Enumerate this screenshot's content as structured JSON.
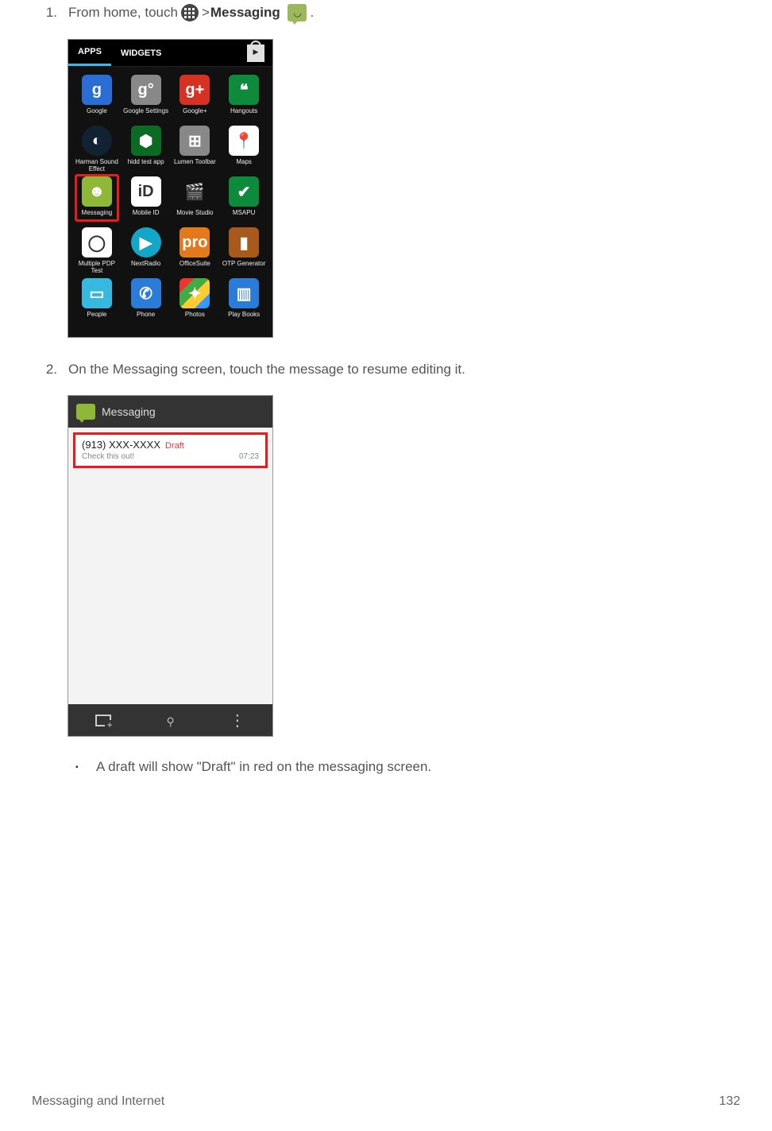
{
  "steps": {
    "one": {
      "num": "1.",
      "text_a": "From home, touch ",
      "text_b": " > ",
      "text_c": "Messaging",
      "text_d": "."
    },
    "two": {
      "num": "2.",
      "text": "On the Messaging screen, touch the message to resume editing it."
    }
  },
  "drawer": {
    "tab_apps": "APPS",
    "tab_widgets": "WIDGETS",
    "apps": [
      {
        "label": "Google",
        "glyph": "g",
        "cls": "bg-blue"
      },
      {
        "label": "Google Settings",
        "glyph": "g°",
        "cls": "bg-gray"
      },
      {
        "label": "Google+",
        "glyph": "g+",
        "cls": "bg-red"
      },
      {
        "label": "Hangouts",
        "glyph": "❝",
        "cls": "bg-green"
      },
      {
        "label": "Harman Sound Effect",
        "glyph": "◐",
        "cls": "bg-dteal"
      },
      {
        "label": "hidd test app",
        "glyph": "⬢",
        "cls": "bg-dgreen"
      },
      {
        "label": "Lumen Toolbar",
        "glyph": "⊞",
        "cls": "bg-gray"
      },
      {
        "label": "Maps",
        "glyph": "📍",
        "cls": "bg-white"
      },
      {
        "label": "Messaging",
        "glyph": "☻",
        "cls": "bg-lime",
        "hl": true
      },
      {
        "label": "Mobile ID",
        "glyph": "iD",
        "cls": "bg-white"
      },
      {
        "label": "Movie Studio",
        "glyph": "🎬",
        "cls": "bg-black"
      },
      {
        "label": "MSAPU",
        "glyph": "✔",
        "cls": "bg-green"
      },
      {
        "label": "Multiple PDP Test",
        "glyph": "◯",
        "cls": "bg-white"
      },
      {
        "label": "NextRadio",
        "glyph": "▶",
        "cls": "bg-teal"
      },
      {
        "label": "OfficeSuite",
        "glyph": "pro",
        "cls": "bg-orange"
      },
      {
        "label": "OTP Generator",
        "glyph": "▮",
        "cls": "bg-dorange"
      },
      {
        "label": "People",
        "glyph": "▭",
        "cls": "bg-cyan"
      },
      {
        "label": "Phone",
        "glyph": "✆",
        "cls": "bg-pblue"
      },
      {
        "label": "Photos",
        "glyph": "✦",
        "cls": "bg-quad"
      },
      {
        "label": "Play Books",
        "glyph": "▥",
        "cls": "bg-pblue"
      }
    ]
  },
  "messaging": {
    "header": "Messaging",
    "row": {
      "subject": "(913) XXX-XXXX",
      "draft": "Draft",
      "preview": "Check this out!",
      "time": "07:23"
    }
  },
  "bullet": "A draft will show \"Draft\" in red on the messaging screen.",
  "footer": {
    "section": "Messaging and Internet",
    "page": "132"
  }
}
